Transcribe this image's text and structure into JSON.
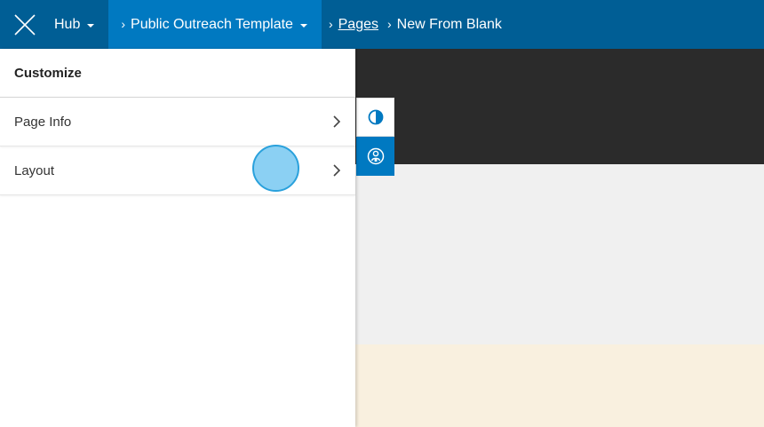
{
  "topbar": {
    "hub_label": "Hub",
    "site_label": "Public Outreach Template",
    "breadcrumb": {
      "pages_label": "Pages",
      "current_label": "New From Blank"
    }
  },
  "panel": {
    "title": "Customize",
    "items": [
      {
        "label": "Page Info"
      },
      {
        "label": "Layout"
      }
    ]
  },
  "tools": {
    "theme_icon": "contrast-icon",
    "accessibility_icon": "accessibility-icon"
  },
  "colors": {
    "topbar": "#005e95",
    "site_button": "#0079c1",
    "preview_dark": "#2b2b2b",
    "preview_gray": "#f0f0f0",
    "preview_cream": "#f9f0df"
  }
}
